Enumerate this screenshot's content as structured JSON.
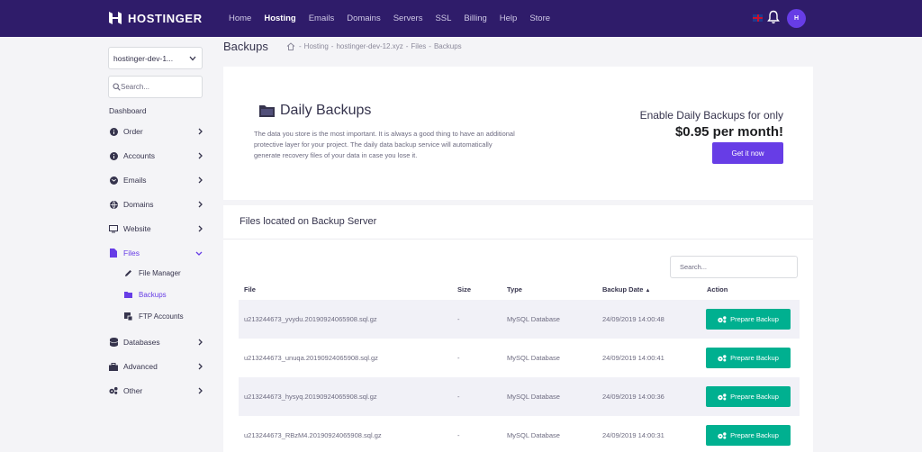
{
  "brand": {
    "name": "HOSTINGER",
    "accent": "#673de6",
    "nav_bg": "#2f1c6a",
    "success": "#00b090"
  },
  "nav": {
    "links": [
      "Home",
      "Hosting",
      "Emails",
      "Domains",
      "Servers",
      "SSL",
      "Billing",
      "Help",
      "Store"
    ],
    "active": "Hosting",
    "avatar_initial": "H"
  },
  "sidebar": {
    "account_select": "hostinger-dev-1...",
    "search_placeholder": "Search...",
    "dashboard_label": "Dashboard",
    "items": [
      {
        "label": "Order",
        "icon": "info-icon"
      },
      {
        "label": "Accounts",
        "icon": "info-icon"
      },
      {
        "label": "Emails",
        "icon": "envelope-icon"
      },
      {
        "label": "Domains",
        "icon": "globe-icon"
      },
      {
        "label": "Website",
        "icon": "monitor-icon"
      },
      {
        "label": "Files",
        "icon": "file-icon"
      },
      {
        "label": "Databases",
        "icon": "database-icon"
      },
      {
        "label": "Advanced",
        "icon": "briefcase-icon"
      },
      {
        "label": "Other",
        "icon": "cogs-icon"
      }
    ],
    "files_sub": [
      {
        "label": "File Manager",
        "icon": "pencil-icon"
      },
      {
        "label": "Backups",
        "icon": "folder-icon"
      },
      {
        "label": "FTP Accounts",
        "icon": "ftp-icon"
      }
    ]
  },
  "page": {
    "title": "Backups",
    "breadcrumb": [
      "Hosting",
      "hostinger-dev-12.xyz",
      "Files",
      "Backups"
    ]
  },
  "promo": {
    "title": "Daily Backups",
    "description": "The data you store is the most important. It is always a good thing to have an additional protective layer for your project. The daily data backup service will automatically generate recovery files of your data in case you lose it.",
    "offer_line": "Enable Daily Backups for only",
    "price_line": "$0.95 per month!",
    "cta_label": "Get it now"
  },
  "files_section": {
    "title": "Files located on Backup Server",
    "search_placeholder": "Search...",
    "columns": [
      "File",
      "Size",
      "Type",
      "Backup Date",
      "Action"
    ],
    "sort_indicator": "▲",
    "rows": [
      {
        "file": "u213244673_yvydu.20190924065908.sql.gz",
        "size": "-",
        "type": "MySQL Database",
        "date": "24/09/2019 14:00:48",
        "action": "Prepare Backup"
      },
      {
        "file": "u213244673_unuqa.20190924065908.sql.gz",
        "size": "-",
        "type": "MySQL Database",
        "date": "24/09/2019 14:00:41",
        "action": "Prepare Backup"
      },
      {
        "file": "u213244673_hysyq.20190924065908.sql.gz",
        "size": "-",
        "type": "MySQL Database",
        "date": "24/09/2019 14:00:36",
        "action": "Prepare Backup"
      },
      {
        "file": "u213244673_RBzM4.20190924065908.sql.gz",
        "size": "-",
        "type": "MySQL Database",
        "date": "24/09/2019 14:00:31",
        "action": "Prepare Backup"
      }
    ]
  }
}
